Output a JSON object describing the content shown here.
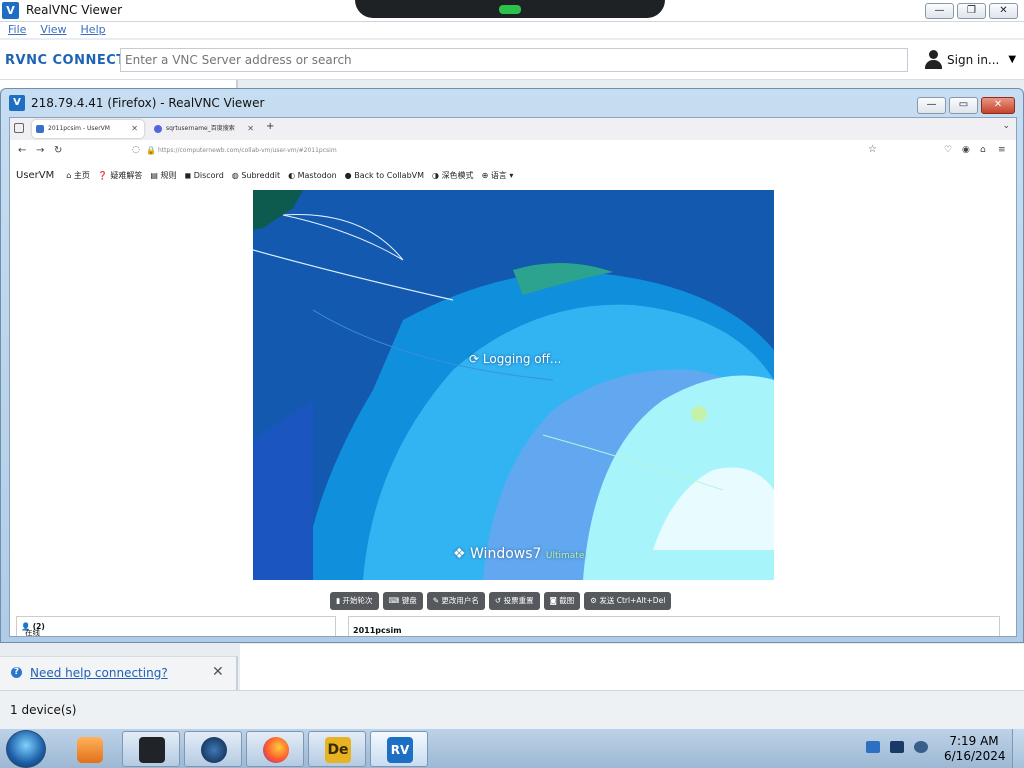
{
  "outer_window": {
    "title": "RealVNC Viewer",
    "menu": [
      "File",
      "View",
      "Help"
    ],
    "logo": "RVNC CONNECT",
    "search_placeholder": "Enter a VNC Server address or search",
    "sign_in": "Sign in...",
    "help_link": "Need help connecting?",
    "status": "1 device(s)"
  },
  "inner_window": {
    "title": "218.79.4.41 (Firefox) - RealVNC Viewer"
  },
  "browser": {
    "tabs": [
      {
        "label": "2011pcsim - UserVM",
        "active": true
      },
      {
        "label": "sqrtusername_百度搜索",
        "active": false
      }
    ],
    "url": "https://computernewb.com/collab-vm/user-vm/#2011pcsim"
  },
  "site_nav": {
    "brand": "UserVM",
    "items": [
      "主页",
      "疑难解答",
      "规则",
      "Discord",
      "Subreddit",
      "Mastodon",
      "Back to CollabVM",
      "深色模式",
      "语言"
    ]
  },
  "vm_screen": {
    "status_text": "Logging off...",
    "os_name": "Windows",
    "os_version": "7",
    "os_edition": "Ultimate"
  },
  "vm_buttons": [
    "开始轮次",
    "键盘",
    "更改用户名",
    "投票重置",
    "截图",
    "发送 Ctrl+Alt+Del"
  ],
  "users_panel": {
    "label": "在线的用户：",
    "count": "(2)"
  },
  "chat_panel": {
    "title": "2011pcsim"
  },
  "taskbar": {
    "time": "7:19 AM",
    "date": "6/16/2024"
  },
  "colors": {
    "accent": "#1d6fc4",
    "vm_bg": "#1a63b6",
    "taskbar": "#b2c9e0"
  }
}
